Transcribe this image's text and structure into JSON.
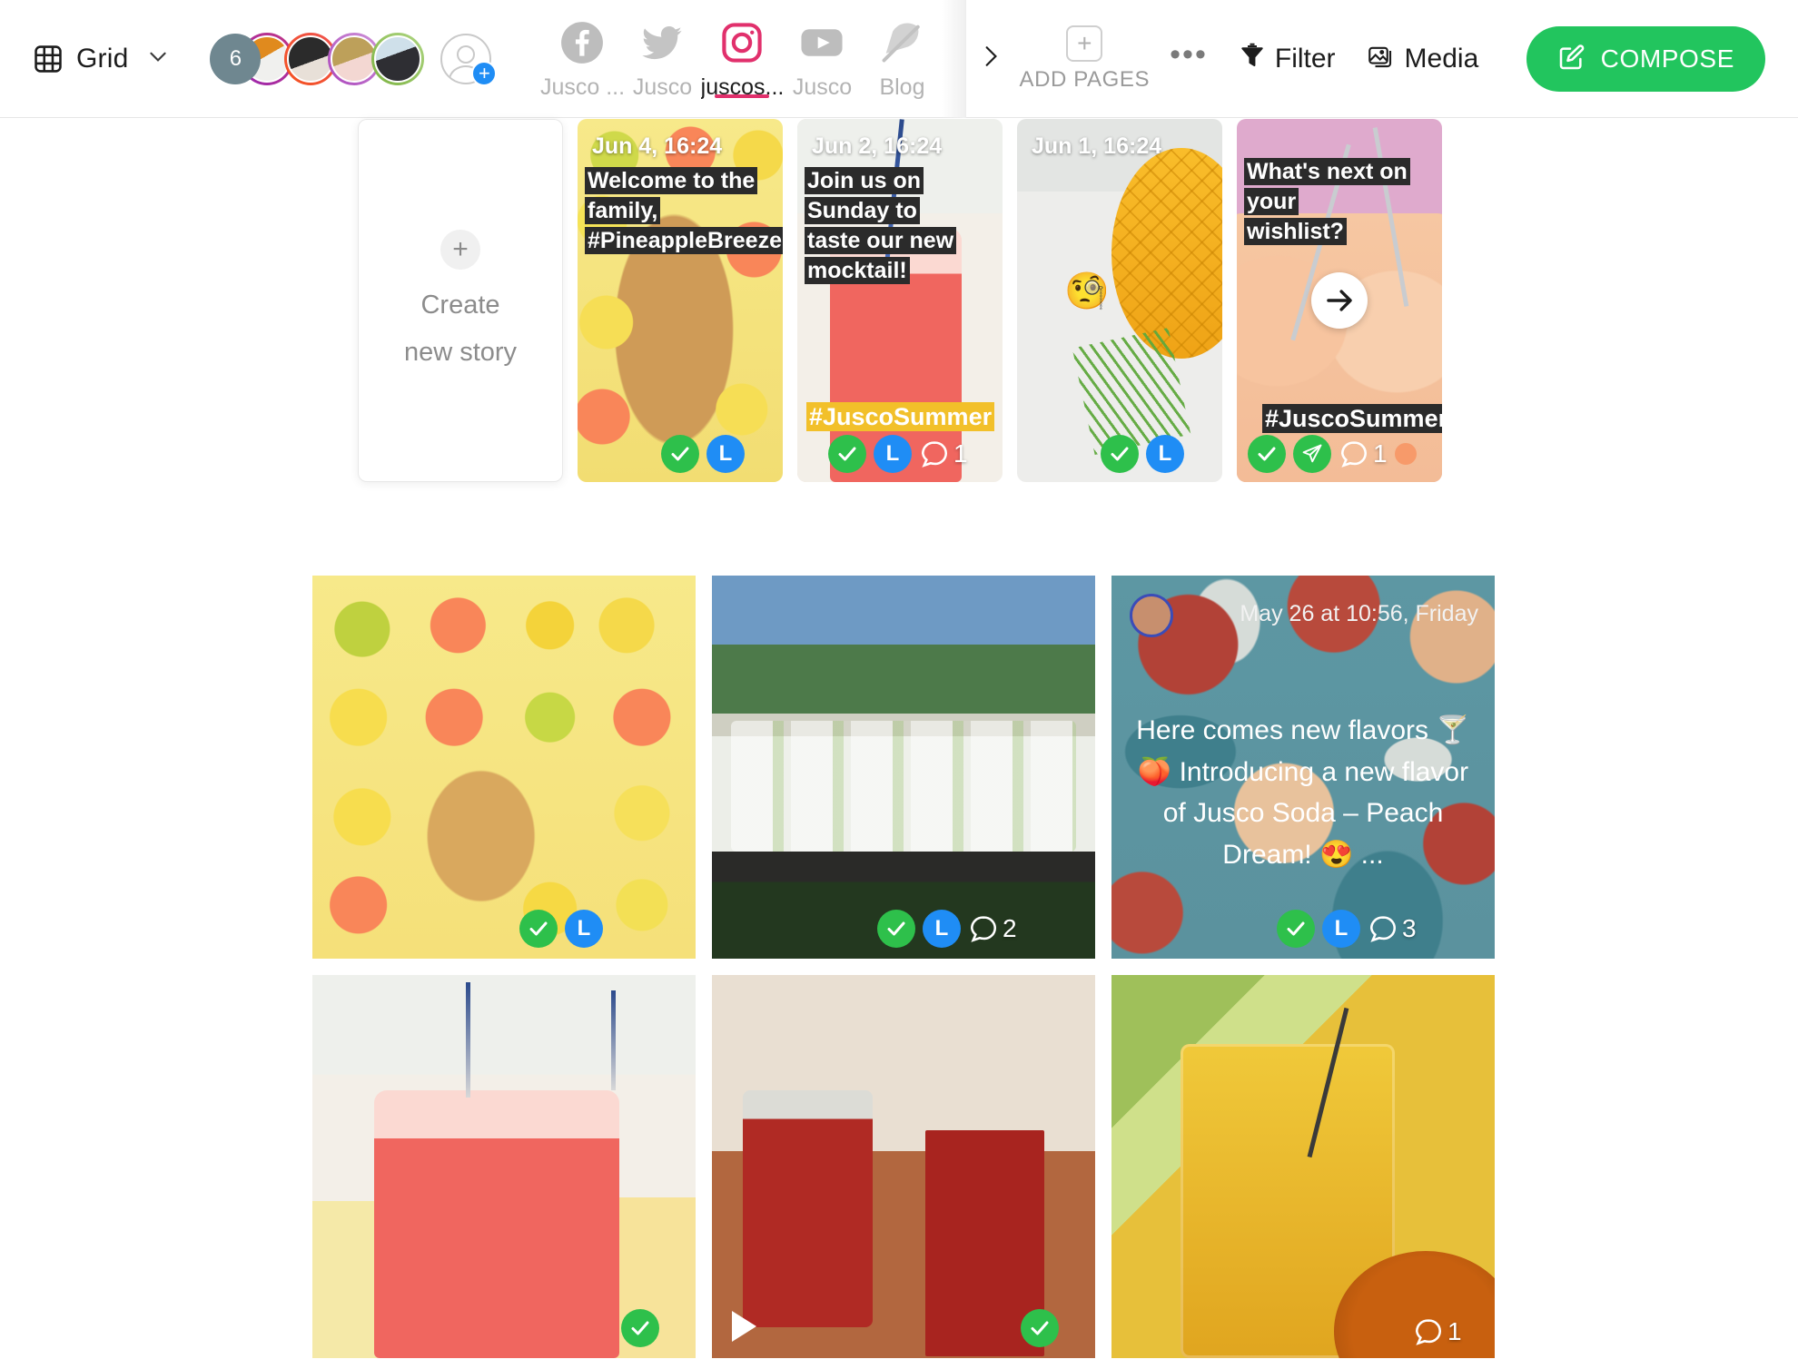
{
  "header": {
    "view_selector": {
      "label": "Grid",
      "icon": "grid-icon",
      "chevron": "chevron-down-icon"
    },
    "avatars": {
      "overflow_count": "6",
      "add_icon": "add-account-icon"
    },
    "channels": [
      {
        "name": "Jusco ...",
        "platform": "facebook",
        "active": false
      },
      {
        "name": "Jusco",
        "platform": "twitter",
        "active": false
      },
      {
        "name": "juscos...",
        "platform": "instagram",
        "active": true
      },
      {
        "name": "Jusco",
        "platform": "youtube",
        "active": false
      },
      {
        "name": "Blog",
        "platform": "blog",
        "active": false
      }
    ],
    "add_pages": {
      "label": "ADD PAGES",
      "icon": "plus-box-icon"
    },
    "more": {
      "label": "•••",
      "icon": "more-options-icon"
    },
    "filter": {
      "label": "Filter",
      "icon": "filter-icon"
    },
    "media": {
      "label": "Media",
      "icon": "media-icon"
    },
    "compose": {
      "label": "COMPOSE",
      "icon": "compose-icon"
    },
    "accent_color": "#e1306c",
    "compose_color": "#22c55e"
  },
  "stories": {
    "create": {
      "line1": "Create",
      "line2": "new story",
      "icon": "plus-icon"
    },
    "items": [
      {
        "date": "Jun 4, 16:24",
        "caption_lines": [
          "Welcome to the family,",
          "#PineappleBreeze"
        ],
        "hashtag": "",
        "comments": "",
        "approved": true,
        "scheduled": true,
        "sent": false,
        "has_next_arrow": false
      },
      {
        "date": "Jun 2, 16:24",
        "caption_lines": [
          "Join us on Sunday to",
          "taste our new",
          "mocktail!"
        ],
        "hashtag": "#JuscoSummer",
        "comments": "1",
        "approved": true,
        "scheduled": true,
        "sent": false,
        "has_next_arrow": false
      },
      {
        "date": "Jun 1, 16:24",
        "caption_lines": [],
        "hashtag": "",
        "comments": "",
        "approved": true,
        "scheduled": true,
        "sent": false,
        "has_next_arrow": false,
        "emoji": "🧐"
      },
      {
        "date": "",
        "caption_lines": [
          "What's next on your",
          "wishlist?"
        ],
        "hashtag": "#JuscoSummer",
        "comments": "1",
        "approved": true,
        "scheduled": false,
        "sent": true,
        "has_next_arrow": true,
        "next_arrow_icon": "arrow-right-icon"
      }
    ]
  },
  "posts": [
    {
      "kind": "image",
      "art": "img-citrus",
      "approved": true,
      "scheduled": true,
      "comments": "",
      "is_video": false
    },
    {
      "kind": "image",
      "art": "img-jars",
      "approved": true,
      "scheduled": true,
      "comments": "2",
      "is_video": false
    },
    {
      "kind": "text-overlay",
      "art": "img-peach",
      "date": "May 26 at 10:56, Friday",
      "caption": "Here comes new flavors 🍸 🍑 Introducing a new flavor of Jusco Soda – Peach Dream! 😍 ...",
      "approved": true,
      "scheduled": true,
      "comments": "3",
      "is_video": false,
      "avatar": "author-avatar"
    },
    {
      "kind": "image",
      "art": "img-pinkjar",
      "approved": true,
      "scheduled": false,
      "comments": "",
      "is_video": false
    },
    {
      "kind": "image",
      "art": "img-redglass",
      "approved": true,
      "scheduled": false,
      "comments": "",
      "is_video": true,
      "play_icon": "play-icon"
    },
    {
      "kind": "image",
      "art": "img-orangejuice",
      "approved": false,
      "scheduled": false,
      "comments": "1",
      "is_video": false
    }
  ],
  "badge_labels": {
    "approved": "approved-check",
    "scheduled": "L",
    "sent": "sent-icon",
    "comment": "comment-icon"
  }
}
